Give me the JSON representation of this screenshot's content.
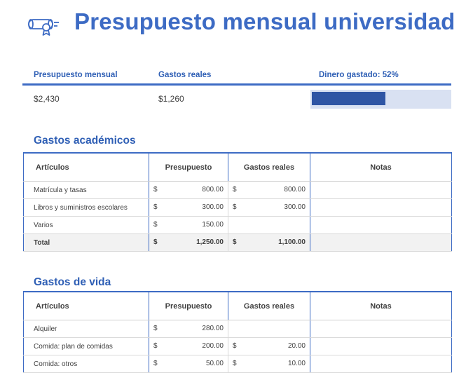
{
  "title": "Presupuesto mensual universidad",
  "icon": "diploma-icon",
  "summary": {
    "budget_label": "Presupuesto mensual",
    "actual_label": "Gastos reales",
    "spent_label": "Dinero gastado: 52%",
    "budget_value": "$2,430",
    "actual_value": "$1,260",
    "spent_fraction": 0.52
  },
  "columns": {
    "items": "Artículos",
    "budget": "Presupuesto",
    "actual": "Gastos reales",
    "notes": "Notas"
  },
  "currency": "$",
  "academic": {
    "title": "Gastos académicos",
    "rows": [
      {
        "item": "Matrícula y tasas",
        "budget": "800.00",
        "actual": "800.00",
        "notes": ""
      },
      {
        "item": "Libros y suministros escolares",
        "budget": "300.00",
        "actual": "300.00",
        "notes": ""
      },
      {
        "item": "Varios",
        "budget": "150.00",
        "actual": "",
        "notes": ""
      }
    ],
    "total": {
      "item": "Total",
      "budget": "1,250.00",
      "actual": "1,100.00"
    }
  },
  "living": {
    "title": "Gastos de vida",
    "rows": [
      {
        "item": "Alquiler",
        "budget": "280.00",
        "actual": "",
        "notes": ""
      },
      {
        "item": "Comida: plan de comidas",
        "budget": "200.00",
        "actual": "20.00",
        "notes": ""
      },
      {
        "item": "Comida: otros",
        "budget": "50.00",
        "actual": "10.00",
        "notes": ""
      }
    ]
  },
  "colors": {
    "accent": "#3d6bc4",
    "bar_fill": "#2f55a4",
    "bar_track": "#d9e1f2"
  }
}
